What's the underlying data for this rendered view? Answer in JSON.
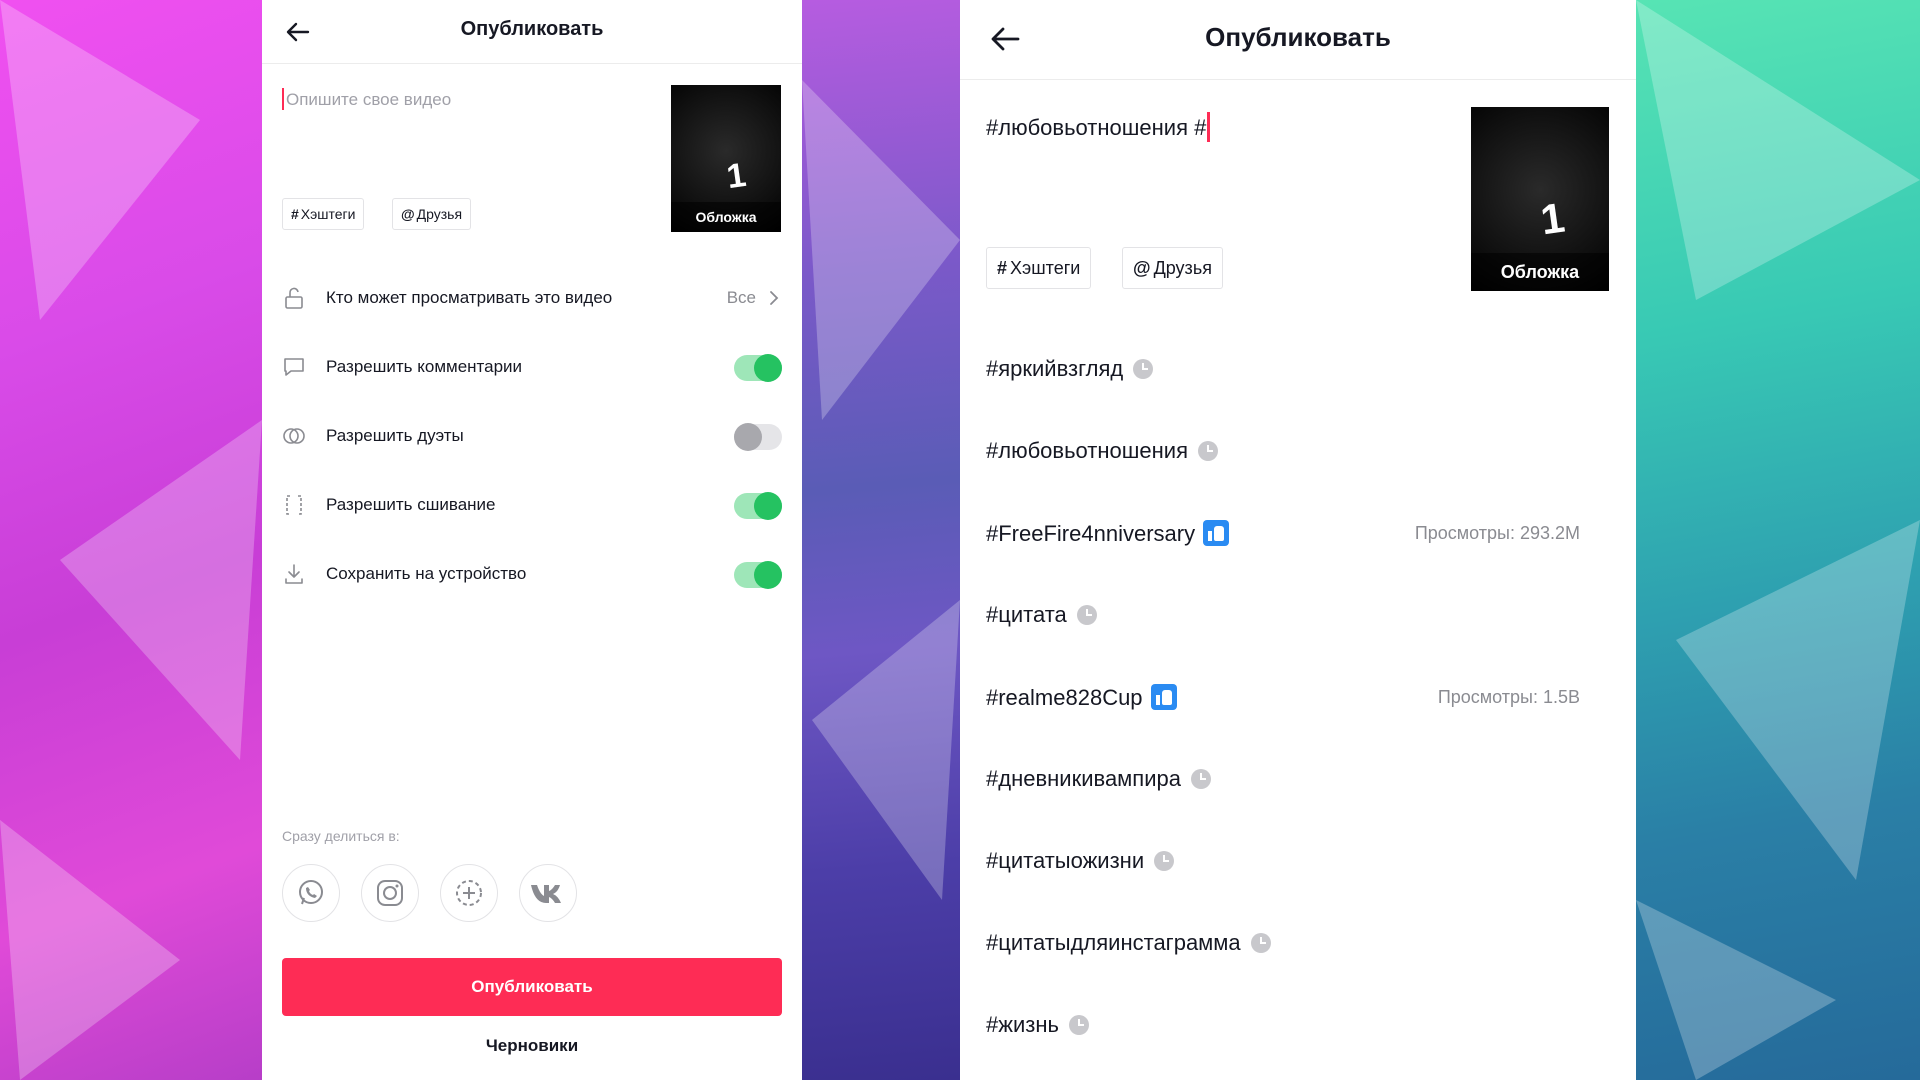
{
  "left_screen": {
    "header": {
      "title": "Опубликовать"
    },
    "description": {
      "placeholder": "Опишите свое видео"
    },
    "chips": {
      "hashtags": "Хэштеги",
      "friends": "Друзья"
    },
    "cover": {
      "number": "1",
      "label": "Обложка"
    },
    "settings": [
      {
        "label": "Кто может просматривать это видео",
        "value": "Все"
      },
      {
        "label": "Разрешить комментарии",
        "enabled": true
      },
      {
        "label": "Разрешить дуэты",
        "enabled": false
      },
      {
        "label": "Разрешить сшивание",
        "enabled": true
      },
      {
        "label": "Сохранить на устройство",
        "enabled": true
      }
    ],
    "share": {
      "label": "Сразу делиться в:",
      "targets": [
        "whatsapp-icon",
        "instagram-icon",
        "add-story-icon",
        "vk-icon"
      ]
    },
    "publish_button": "Опубликовать",
    "drafts_button": "Черновики"
  },
  "right_screen": {
    "header": {
      "title": "Опубликовать"
    },
    "description": {
      "value": "#любовьотношения #"
    },
    "chips": {
      "hashtags": "Хэштеги",
      "friends": "Друзья"
    },
    "cover": {
      "number": "1",
      "label": "Обложка"
    },
    "suggestions": [
      {
        "tag": "#яркийвзгляд",
        "icon": "clock-icon"
      },
      {
        "tag": "#любовьотношения",
        "icon": "clock-icon"
      },
      {
        "tag": "#FreeFire4nniversary",
        "icon": "thumbs-up-icon",
        "views": "Просмотры: 293.2M"
      },
      {
        "tag": "#цитата",
        "icon": "clock-icon"
      },
      {
        "tag": "#realme828Cup",
        "icon": "thumbs-up-icon",
        "views": "Просмотры: 1.5B"
      },
      {
        "tag": "#дневникивампира",
        "icon": "clock-icon"
      },
      {
        "tag": "#цитатыожизни",
        "icon": "clock-icon"
      },
      {
        "tag": "#цитатыдляинстаграмма",
        "icon": "clock-icon"
      },
      {
        "tag": "#жизнь",
        "icon": "clock-icon"
      }
    ]
  },
  "colors": {
    "accent": "#fe2c55",
    "toggle_on": "#25c261",
    "toggle_off": "#a8a8ad",
    "badge_blue": "#2a8bf2"
  }
}
